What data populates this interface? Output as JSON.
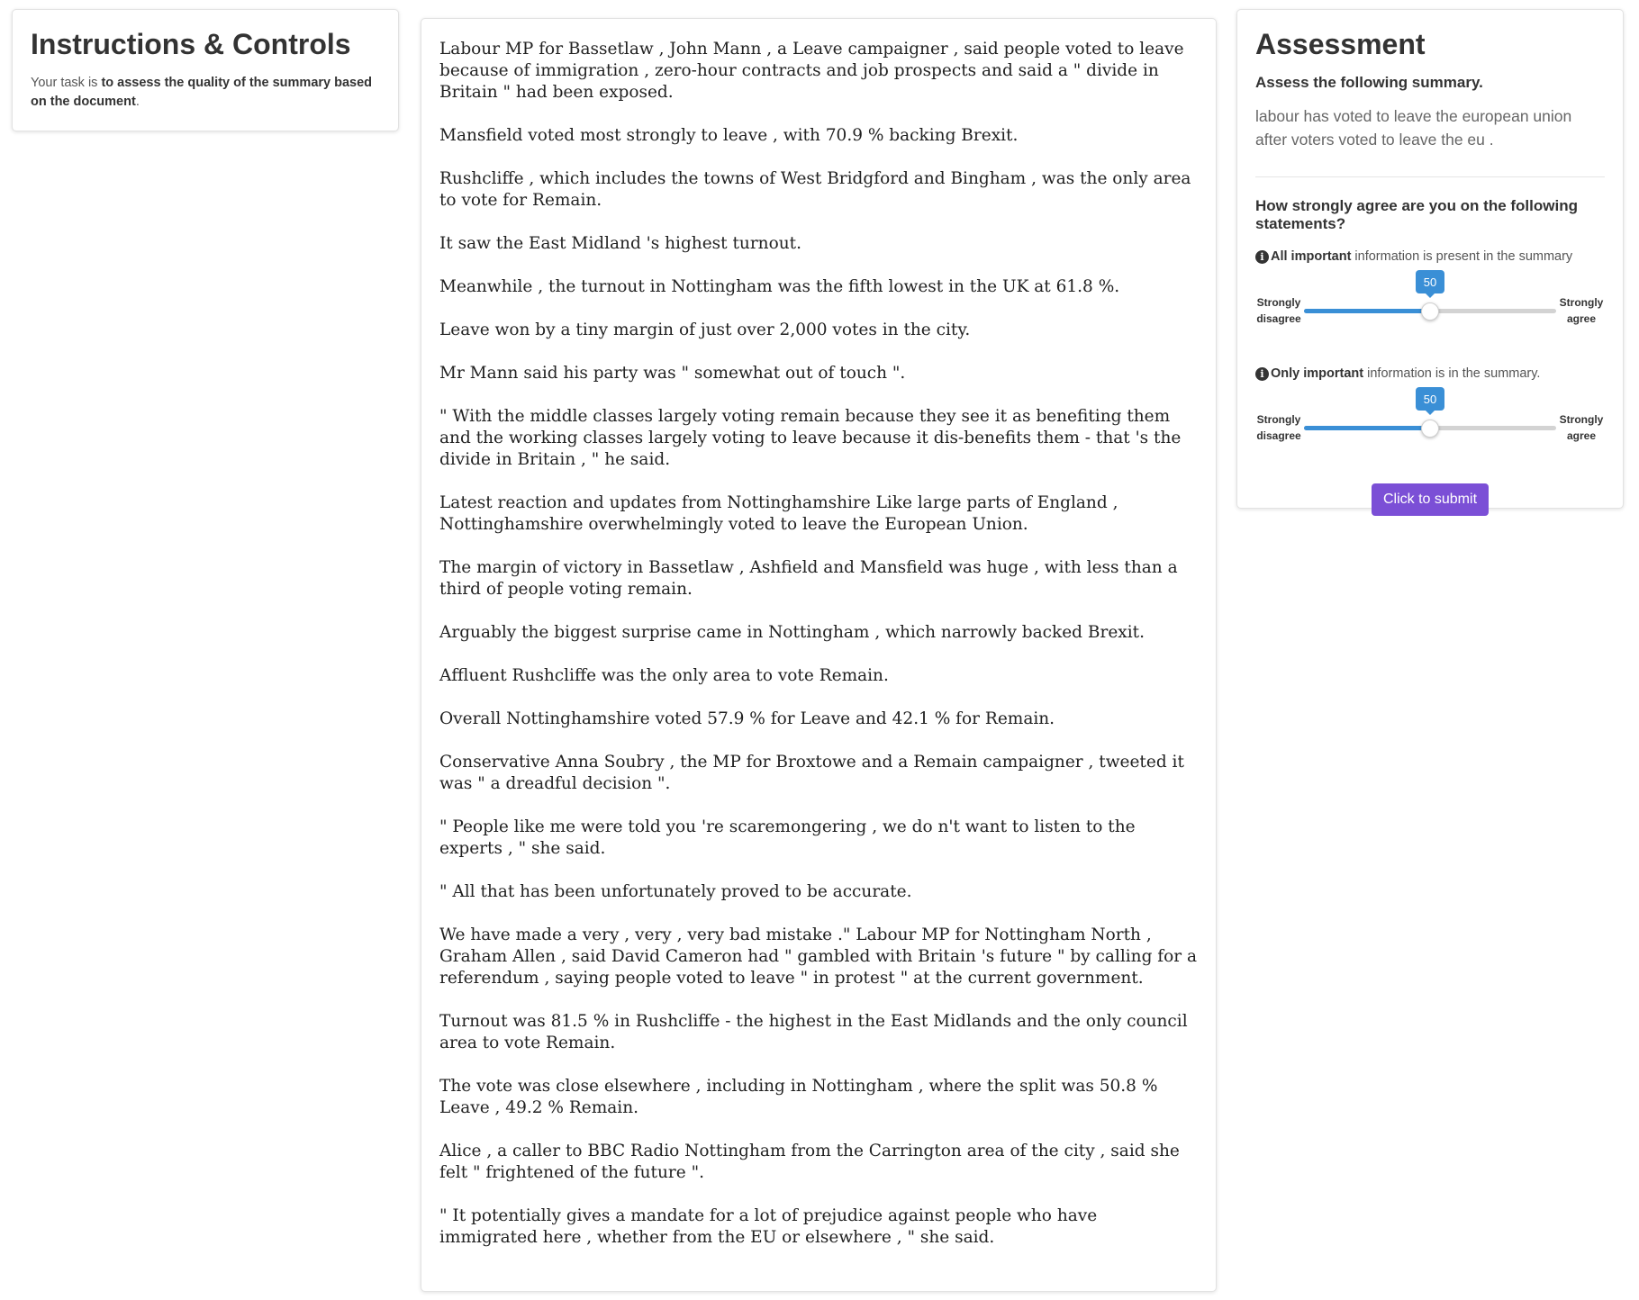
{
  "instructions": {
    "title": "Instructions & Controls",
    "text_prefix": "Your task is ",
    "text_bold": "to assess the quality of the summary based on the document",
    "text_suffix": "."
  },
  "document": {
    "paragraphs": [
      "Labour MP for Bassetlaw , John Mann , a Leave campaigner , said people voted to leave because of immigration , zero-hour contracts and job prospects and said a \" divide in Britain \" had been exposed.",
      "Mansfield voted most strongly to leave , with 70.9 % backing Brexit.",
      "Rushcliffe , which includes the towns of West Bridgford and Bingham , was the only area to vote for Remain.",
      "It saw the East Midland 's highest turnout.",
      "Meanwhile , the turnout in Nottingham was the fifth lowest in the UK at 61.8 %.",
      "Leave won by a tiny margin of just over 2,000 votes in the city.",
      "Mr Mann said his party was \" somewhat out of touch \".",
      "\" With the middle classes largely voting remain because they see it as benefiting them and the working classes largely voting to leave because it dis-benefits them - that 's the divide in Britain , \" he said.",
      "Latest reaction and updates from Nottinghamshire Like large parts of England , Nottinghamshire overwhelmingly voted to leave the European Union.",
      "The margin of victory in Bassetlaw , Ashfield and Mansfield was huge , with less than a third of people voting remain.",
      "Arguably the biggest surprise came in Nottingham , which narrowly backed Brexit.",
      "Affluent Rushcliffe was the only area to vote Remain.",
      "Overall Nottinghamshire voted 57.9 % for Leave and 42.1 % for Remain.",
      "Conservative Anna Soubry , the MP for Broxtowe and a Remain campaigner , tweeted it was \" a dreadful decision \".",
      "\" People like me were told you 're scaremongering , we do n't want to listen to the experts , \" she said.",
      "\" All that has been unfortunately proved to be accurate.",
      "We have made a very , very , very bad mistake .\" Labour MP for Nottingham North , Graham Allen , said David Cameron had \" gambled with Britain 's future \" by calling for a referendum , saying people voted to leave \" in protest \" at the current government.",
      "Turnout was 81.5 % in Rushcliffe - the highest in the East Midlands and the only council area to vote Remain.",
      "The vote was close elsewhere , including in Nottingham , where the split was 50.8 % Leave , 49.2 % Remain.",
      "Alice , a caller to BBC Radio Nottingham from the Carrington area of the city , said she felt \" frightened of the future \".",
      "\" It potentially gives a mandate for a lot of prejudice against people who have immigrated here , whether from the EU or elsewhere , \" she said."
    ]
  },
  "assessment": {
    "title": "Assessment",
    "subtitle": "Assess the following summary.",
    "summary": "labour has voted to leave the european union after voters voted to leave the eu .",
    "question": "How strongly agree are you on the following statements?",
    "info_icon": "info-circle-icon",
    "sliders": [
      {
        "bold": "All important",
        "rest": "information is present in the summary",
        "left_label_1": "Strongly",
        "left_label_2": "disagree",
        "right_label_1": "Strongly",
        "right_label_2": "agree",
        "value": "50",
        "fraction": 0.5
      },
      {
        "bold": "Only important",
        "rest": "information is in the summary.",
        "left_label_1": "Strongly",
        "left_label_2": "disagree",
        "right_label_1": "Strongly",
        "right_label_2": "agree",
        "value": "50",
        "fraction": 0.5
      }
    ],
    "submit_label": "Click to submit"
  },
  "colors": {
    "slider_fill": "#3a8fd6",
    "submit_button": "#7b4fd6"
  }
}
